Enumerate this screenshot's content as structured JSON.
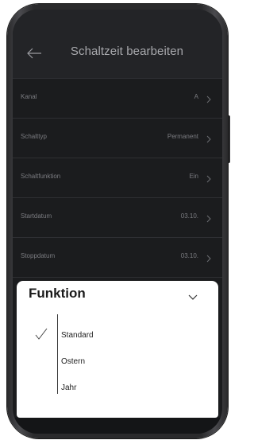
{
  "header": {
    "title": "Schaltzeit bearbeiten",
    "back_icon": "arrow-left-icon"
  },
  "settings": [
    {
      "label": "Kanal",
      "value": "A"
    },
    {
      "label": "Schalttyp",
      "value": "Permanent"
    },
    {
      "label": "Schaltfunktion",
      "value": "Ein"
    },
    {
      "label": "Startdatum",
      "value": "03.10."
    },
    {
      "label": "Stoppdatum",
      "value": "03.10."
    }
  ],
  "sheet": {
    "title": "Funktion",
    "collapse_icon": "chevron-down-icon",
    "options": [
      {
        "label": "Standard",
        "selected": true
      },
      {
        "label": "Ostern",
        "selected": false
      },
      {
        "label": "Jahr",
        "selected": false
      }
    ]
  },
  "colors": {
    "screen_bg": "#1b1c1e",
    "header_bg": "#232427",
    "sheet_bg": "#ffffff"
  }
}
